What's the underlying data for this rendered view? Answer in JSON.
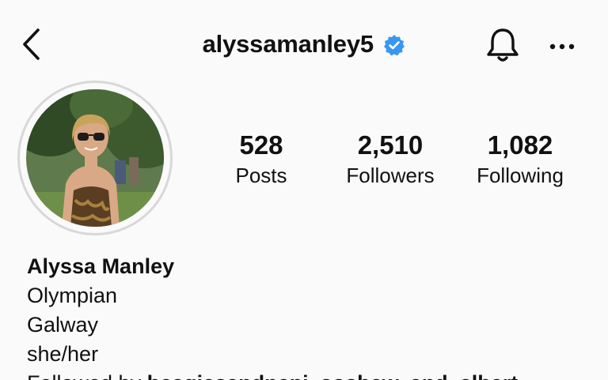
{
  "header": {
    "username": "alyssamanley5",
    "verified_color": "#3897f0",
    "back_icon": "chevron-left-icon",
    "bell_icon": "bell-icon",
    "more_icon": "more-horizontal-icon"
  },
  "stats": {
    "posts": {
      "value": "528",
      "label": "Posts"
    },
    "followers": {
      "value": "2,510",
      "label": "Followers"
    },
    "following": {
      "value": "1,082",
      "label": "Following"
    }
  },
  "bio": {
    "name": "Alyssa Manley",
    "lines": [
      "Olympian",
      "Galway",
      "she/her"
    ],
    "followed_by_prefix": "Followed by ",
    "followed_by_names": "beagiesandpepi, sosbew, and_albert"
  }
}
